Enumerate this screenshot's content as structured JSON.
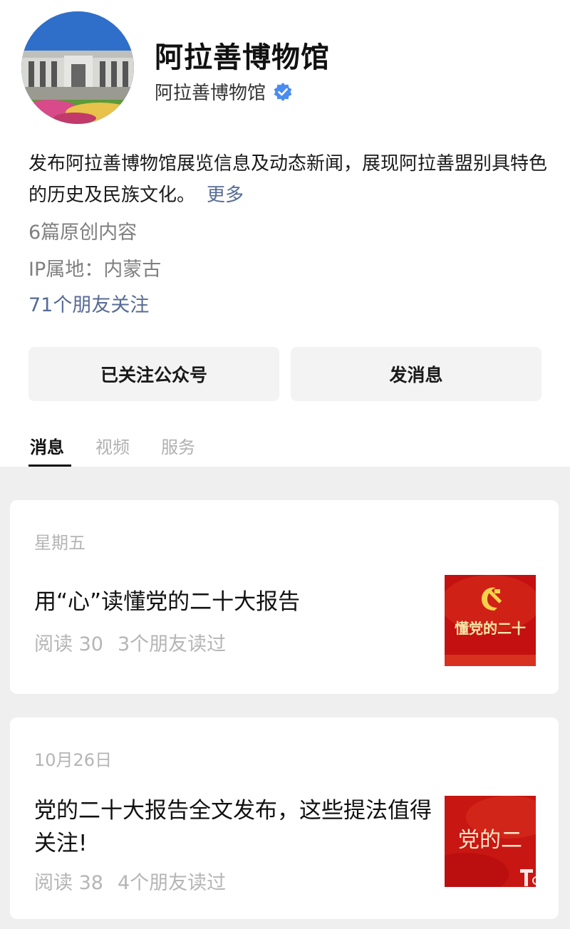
{
  "profile": {
    "name": "阿拉善博物馆",
    "subname": "阿拉善博物馆",
    "description": "发布阿拉善博物馆展览信息及动态新闻，展现阿拉善盟别具特色的历史及民族文化。",
    "more": "更多",
    "originals": "6篇原创内容",
    "ip_location": "IP属地：内蒙古",
    "friends_following": "71个朋友关注"
  },
  "actions": {
    "follow_label": "已关注公众号",
    "message_label": "发消息"
  },
  "tabs": [
    {
      "label": "消息",
      "active": true
    },
    {
      "label": "视频",
      "active": false
    },
    {
      "label": "服务",
      "active": false
    }
  ],
  "articles": [
    {
      "date": "星期五",
      "title": "用“心”读懂党的二十大报告",
      "reads": "阅读 30",
      "friends_read": "3个朋友读过",
      "thumb_text": "懂党的二十"
    },
    {
      "date": "10月26日",
      "title": "党的二十大报告全文发布，这些提法值得关注!",
      "reads": "阅读 38",
      "friends_read": "4个朋友读过",
      "thumb_text": "党的二"
    }
  ],
  "icons": {
    "verified": "verified-badge-icon",
    "emblem": "party-emblem-icon"
  },
  "colors": {
    "link": "#576b95",
    "verified": "#4a8cf0",
    "thumb_red": "#c41010"
  }
}
